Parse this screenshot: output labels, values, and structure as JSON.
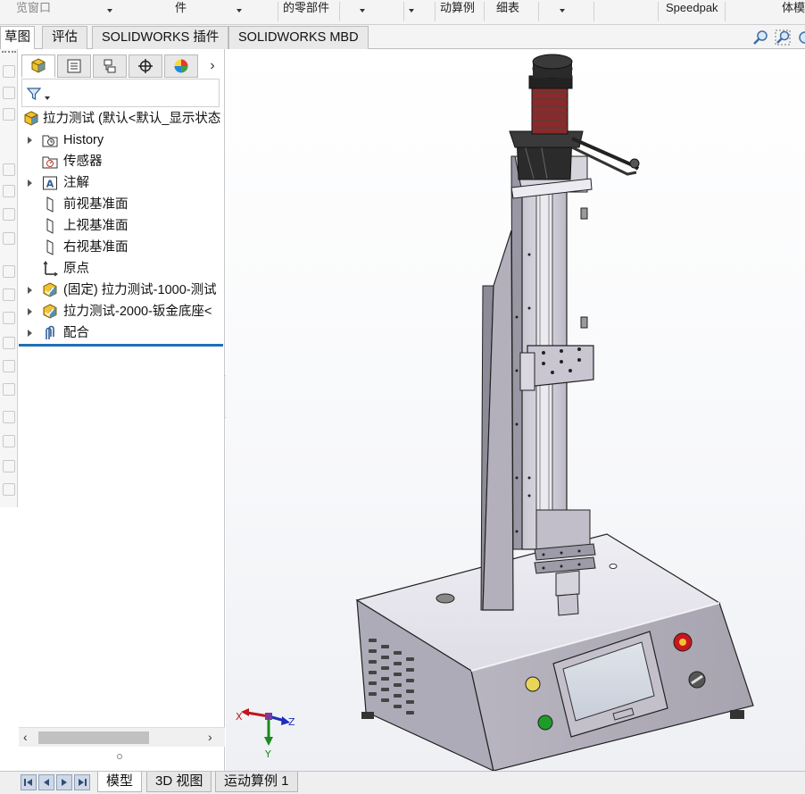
{
  "ribbon": {
    "items": [
      {
        "label": "览窗口",
        "dim": true
      },
      {
        "label": "件"
      },
      {
        "label": "的零部件"
      },
      {
        "label": "动算例"
      },
      {
        "label": "细表"
      },
      {
        "label": "Speedpak"
      },
      {
        "label": "体模"
      }
    ]
  },
  "command_tabs": [
    "草图",
    "评估",
    "SOLIDWORKS 插件",
    "SOLIDWORKS MBD"
  ],
  "feature_manager": {
    "tabs": [
      "feature-manager-tree-icon",
      "property-manager-icon",
      "configuration-manager-icon",
      "dimxpert-icon",
      "display-manager-icon"
    ],
    "tree": [
      {
        "label": "拉力测试  (默认<默认_显示状态",
        "icon": "assembly-icon",
        "expander": false,
        "level": 0
      },
      {
        "label": "History",
        "icon": "history-icon",
        "expander": true,
        "level": 1
      },
      {
        "label": "传感器",
        "icon": "sensor-icon",
        "expander": false,
        "level": 1
      },
      {
        "label": "注解",
        "icon": "annotation-icon",
        "expander": true,
        "level": 1
      },
      {
        "label": "前视基准面",
        "icon": "plane-icon",
        "expander": false,
        "level": 1
      },
      {
        "label": "上视基准面",
        "icon": "plane-icon",
        "expander": false,
        "level": 1
      },
      {
        "label": "右视基准面",
        "icon": "plane-icon",
        "expander": false,
        "level": 1
      },
      {
        "label": "原点",
        "icon": "origin-icon",
        "expander": false,
        "level": 1
      },
      {
        "label": "(固定) 拉力测试-1000-测试",
        "icon": "subassembly-icon",
        "expander": true,
        "level": 1
      },
      {
        "label": "拉力测试-2000-钣金底座<",
        "icon": "subassembly-icon",
        "expander": true,
        "level": 1
      },
      {
        "label": "配合",
        "icon": "mates-icon",
        "expander": true,
        "level": 1
      }
    ]
  },
  "triad": {
    "x": "X",
    "y": "Y",
    "z": "Z"
  },
  "bottom_tabs": [
    "模型",
    "3D 视图",
    "运动算例 1"
  ],
  "colors": {
    "accent": "#1f6fb5",
    "machine_body": "#b9b6c2",
    "panel_light": "#e4e2ea",
    "rail": "#ccc9d4"
  }
}
